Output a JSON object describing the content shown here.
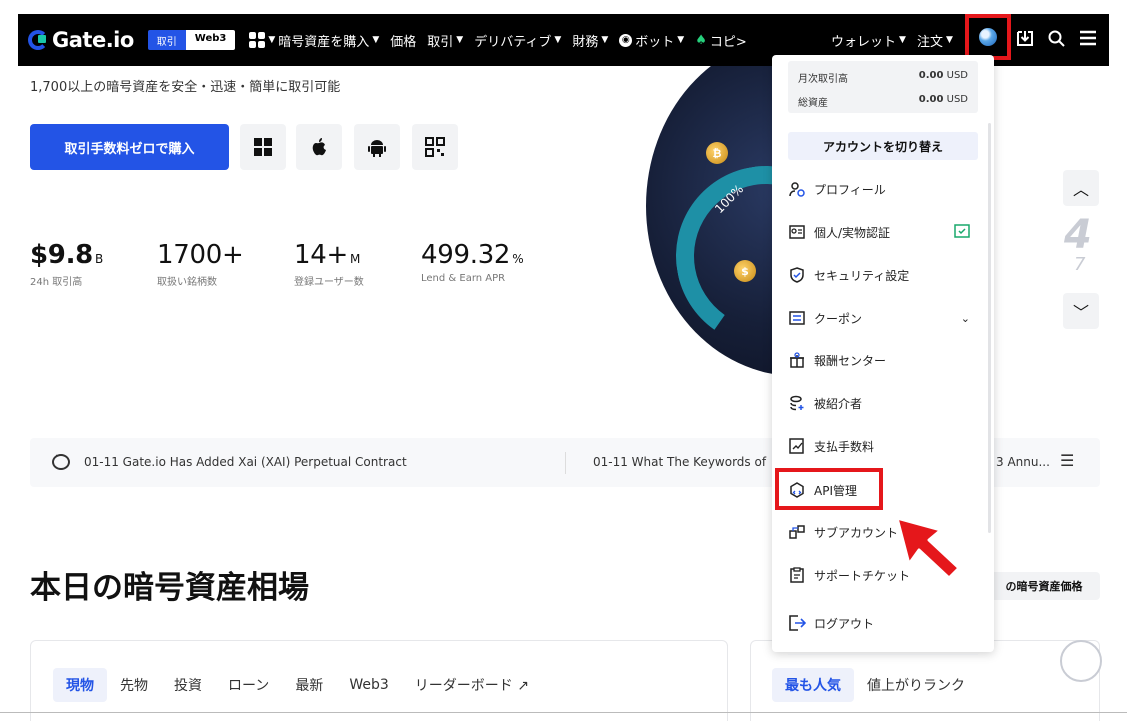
{
  "nav": {
    "logo_text": "Gate.io",
    "mode_trade": "取引",
    "mode_web3": "Web3",
    "items": [
      "暗号資産を購入",
      "価格",
      "取引",
      "デリバティブ",
      "財務",
      "ボット",
      "コピ>"
    ],
    "wallet": "ウォレット",
    "orders": "注文"
  },
  "hero": {
    "subtitle": "1,700以上の暗号資産を安全・迅速・簡単に取引可能",
    "buy_button": "取引手数料ゼロで購入",
    "stats": [
      {
        "value": "$9.8",
        "unit": "B",
        "label": "24h 取引高"
      },
      {
        "value": "1700+",
        "unit": "",
        "label": "取扱い銘柄数"
      },
      {
        "value": "14+",
        "unit": "M",
        "label": "登録ユーザー数"
      },
      {
        "value": "499.32",
        "unit": "%",
        "label": "Lend & Earn APR"
      }
    ],
    "art_percent": "100%",
    "carousel_num": "4",
    "carousel_num2": "7"
  },
  "announcements": {
    "item1": "01-11 Gate.io Has Added Xai (XAI) Perpetual Contract",
    "item2": "01-11 What The Keywords of",
    "item3": "3 Annu..."
  },
  "market": {
    "title": "本日の暗号資産相場",
    "price_pill": "の暗号資産価格",
    "tabs": [
      "現物",
      "先物",
      "投資",
      "ローン",
      "最新",
      "Web3",
      "リーダーボード ↗"
    ],
    "tabs2": [
      "最も人気",
      "値上がりランク"
    ]
  },
  "dropdown": {
    "monthly_volume_label": "月次取引高",
    "monthly_volume_value": "0.00",
    "total_assets_label": "総資産",
    "total_assets_value": "0.00",
    "currency": "USD",
    "switch_account": "アカウントを切り替え",
    "items": [
      {
        "label": "プロフィール",
        "icon": "profile-icon"
      },
      {
        "label": "個人/実物認証",
        "icon": "id-card-icon"
      },
      {
        "label": "セキュリティ設定",
        "icon": "shield-icon"
      },
      {
        "label": "クーポン",
        "icon": "coupon-icon"
      },
      {
        "label": "報酬センター",
        "icon": "gift-icon"
      },
      {
        "label": "被紹介者",
        "icon": "referral-icon"
      },
      {
        "label": "支払手数料",
        "icon": "fee-icon"
      },
      {
        "label": "API管理",
        "icon": "api-icon"
      },
      {
        "label": "サブアカウント",
        "icon": "sub-account-icon"
      },
      {
        "label": "サポートチケット",
        "icon": "ticket-icon"
      }
    ],
    "logout": "ログアウト"
  },
  "colors": {
    "brand_blue": "#2354e6",
    "highlight_red": "#e5171b",
    "nav_bg": "#000000"
  }
}
